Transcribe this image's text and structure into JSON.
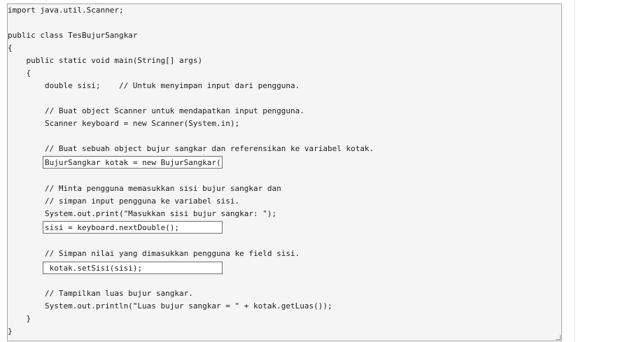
{
  "code": {
    "lines": [
      "import java.util.Scanner;",
      "",
      "public class TesBujurSangkar",
      "{",
      "    public static void main(String[] args)",
      "    {",
      "        double sisi;    // Untuk menyimpan input dari pengguna.",
      "",
      "        // Buat object Scanner untuk mendapatkan input pengguna.",
      "        Scanner keyboard = new Scanner(System.in);",
      "",
      "        // Buat sebuah object bujur sangkar dan referensikan ke variabel kotak.",
      "",
      "",
      "        // Minta pengguna memasukkan sisi bujur sangkar dan",
      "        // simpan input pengguna ke variabel sisi.",
      "        System.out.print(\"Masukkan sisi bujur sangkar: \");",
      "",
      "",
      "        // Simpan nilai yang dimasukkan pengguna ke field sisi.",
      "",
      "",
      "        // Tampilkan luas bujur sangkar.",
      "        System.out.println(\"Luas bujur sangkar = \" + kotak.getLuas());",
      "    }",
      "}"
    ]
  },
  "answers": {
    "box1": "BujurSangkar kotak = new BujurSangkar();",
    "box2": "sisi = keyboard.nextDouble();",
    "box3": " kotak.setSisi(sisi);"
  }
}
